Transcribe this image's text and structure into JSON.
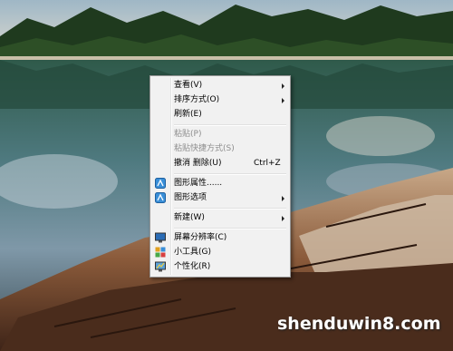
{
  "menu": {
    "items": [
      {
        "label": "查看(V)",
        "submenu": true,
        "enabled": true
      },
      {
        "label": "排序方式(O)",
        "submenu": true,
        "enabled": true
      },
      {
        "label": "刷新(E)",
        "enabled": true
      },
      {
        "label": "粘贴(P)",
        "enabled": false
      },
      {
        "label": "粘贴快捷方式(S)",
        "enabled": false
      },
      {
        "label": "撤消 删除(U)",
        "shortcut": "Ctrl+Z",
        "enabled": true
      },
      {
        "label": "图形属性......",
        "icon": "graphics-properties-icon",
        "enabled": true
      },
      {
        "label": "图形选项",
        "icon": "graphics-options-icon",
        "submenu": true,
        "enabled": true
      },
      {
        "label": "新建(W)",
        "submenu": true,
        "enabled": true
      },
      {
        "label": "屏幕分辨率(C)",
        "icon": "screen-resolution-icon",
        "enabled": true
      },
      {
        "label": "小工具(G)",
        "icon": "gadgets-icon",
        "enabled": true
      },
      {
        "label": "个性化(R)",
        "icon": "personalize-icon",
        "enabled": true
      }
    ]
  },
  "watermark": "shenduwin8.com",
  "colors": {
    "menu_bg": "#f1f1f1",
    "menu_border": "#979797",
    "disabled_text": "#8d8d8d"
  }
}
